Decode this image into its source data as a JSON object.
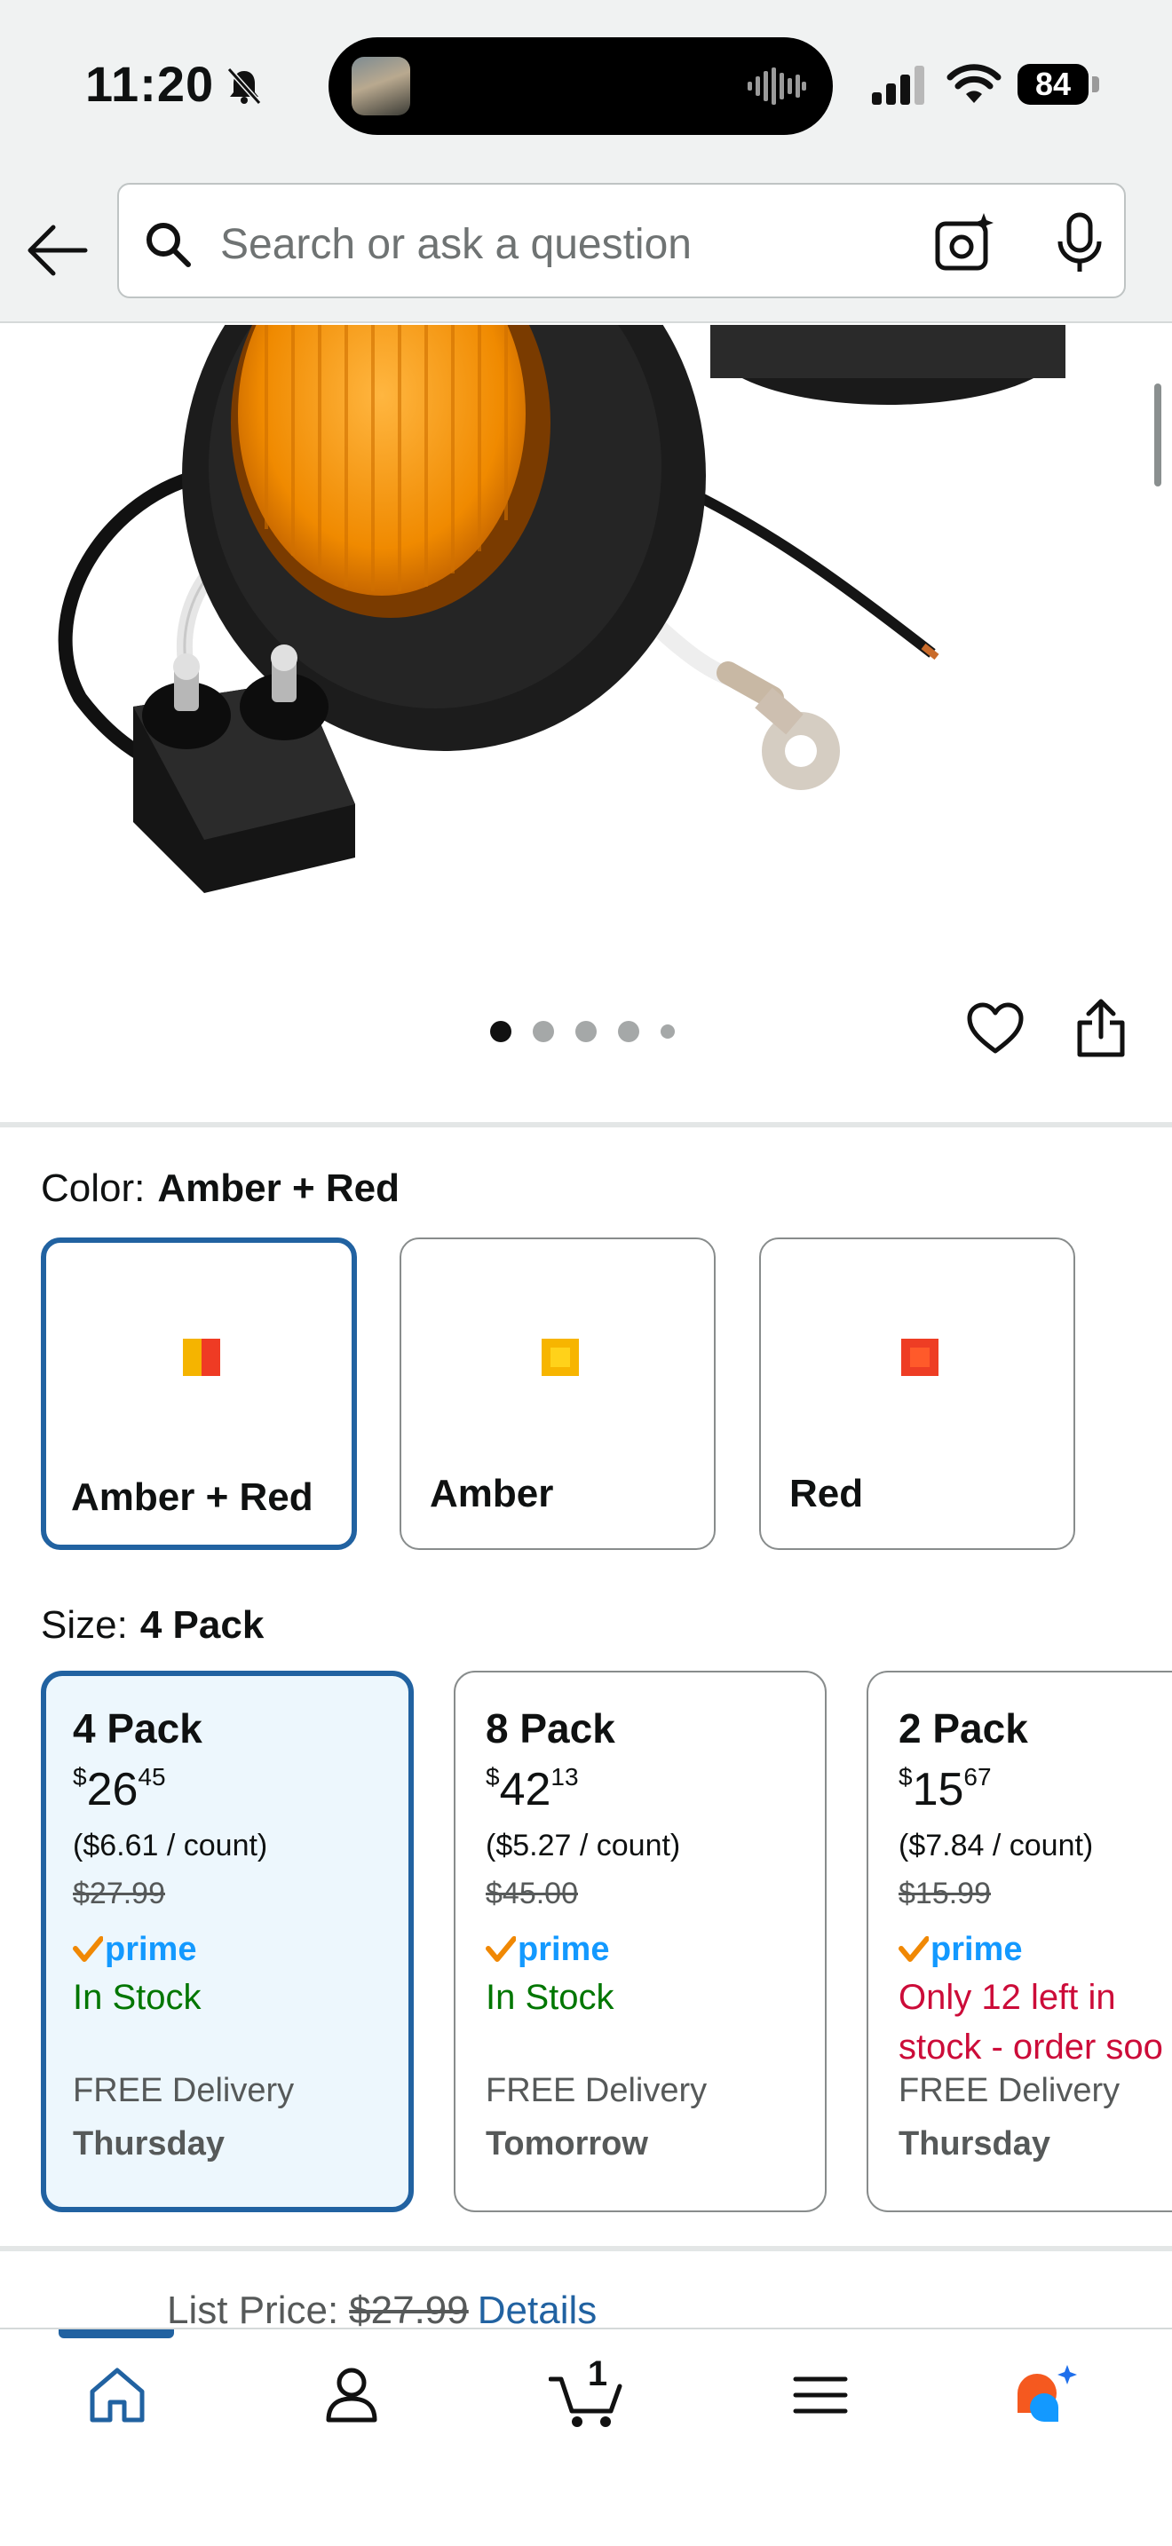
{
  "status_bar": {
    "time": "11:20",
    "battery": "84"
  },
  "search": {
    "placeholder": "Search or ask a question"
  },
  "product_image": {
    "pages": 5,
    "active_page": 1
  },
  "color": {
    "label": "Color:",
    "selected": "Amber + Red",
    "options": [
      {
        "name": "Amber + Red",
        "swatch": [
          "#f5b400",
          "#ef3b24"
        ],
        "selected": true
      },
      {
        "name": "Amber",
        "swatch": [
          "#f7b500"
        ],
        "selected": false
      },
      {
        "name": "Red",
        "swatch": [
          "#ee3d24"
        ],
        "selected": false
      }
    ]
  },
  "size": {
    "label": "Size:",
    "selected": "4 Pack",
    "options": [
      {
        "name": "4 Pack",
        "currency": "$",
        "dollars": "26",
        "cents": "45",
        "unit_price": "($6.61 / count)",
        "was": "$27.99",
        "prime": "prime",
        "stock": "In Stock",
        "delivery": "FREE Delivery",
        "day": "Thursday",
        "selected": true
      },
      {
        "name": "8 Pack",
        "currency": "$",
        "dollars": "42",
        "cents": "13",
        "unit_price": "($5.27 / count)",
        "was": "$45.00",
        "prime": "prime",
        "stock": "In Stock",
        "delivery": "FREE Delivery",
        "day": "Tomorrow",
        "selected": false
      },
      {
        "name": "2 Pack",
        "currency": "$",
        "dollars": "15",
        "cents": "67",
        "unit_price": "($7.84 / count)",
        "was": "$15.99",
        "prime": "prime",
        "stock": "Only 12 left in stock - order soo",
        "delivery": "FREE Delivery",
        "day": "Thursday",
        "selected": false
      }
    ]
  },
  "list_price": {
    "label": "List Price:",
    "value": "$27.99",
    "link": "Details"
  },
  "bottom_nav": {
    "items": [
      "home-icon",
      "account-icon",
      "cart-icon",
      "menu-icon",
      "rufus-icon"
    ],
    "cart_count": "1"
  },
  "colors": {
    "link_blue": "#2162a1",
    "prime_blue": "#1399ff",
    "in_stock_green": "#007600",
    "low_stock_red": "#cc0c39"
  }
}
